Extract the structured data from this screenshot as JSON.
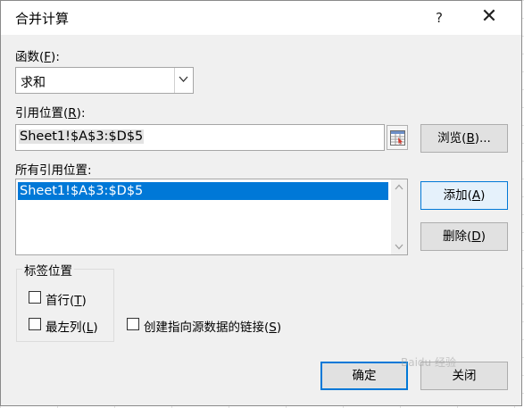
{
  "dialog": {
    "title": "合并计算",
    "help": "?",
    "close": "✕"
  },
  "function": {
    "label_text": "函数(",
    "label_key": "F",
    "label_end": "):",
    "value": "求和"
  },
  "reference": {
    "label_text": "引用位置(",
    "label_key": "R",
    "label_end": "):",
    "value": "Sheet1!$A$3:$D$5",
    "browse_text": "浏览(",
    "browse_key": "B",
    "browse_end": ")..."
  },
  "all_references": {
    "label": "所有引用位置:",
    "items": [
      "Sheet1!$A$3:$D$5"
    ],
    "add_text": "添加(",
    "add_key": "A",
    "add_end": ")",
    "delete_text": "删除(",
    "delete_key": "D",
    "delete_end": ")"
  },
  "label_position": {
    "title": "标签位置",
    "top_row_text": "首行(",
    "top_row_key": "T",
    "top_row_end": ")",
    "left_col_text": "最左列(",
    "left_col_key": "L",
    "left_col_end": ")",
    "top_row_checked": false,
    "left_col_checked": false
  },
  "links": {
    "text": "创建指向源数据的链接(",
    "key": "S",
    "end": ")",
    "checked": false
  },
  "footer": {
    "ok": "确定",
    "close": "关闭"
  },
  "watermark": "Baidu 经验"
}
